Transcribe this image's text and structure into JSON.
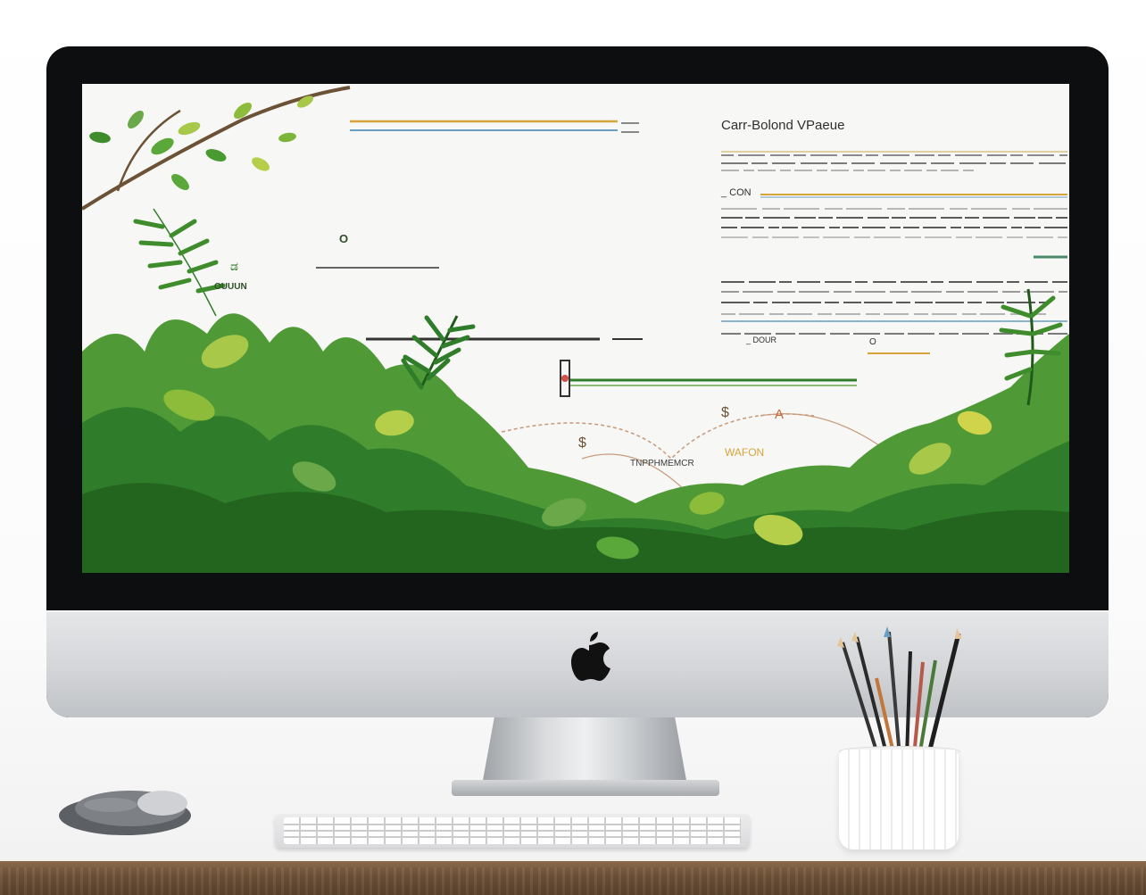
{
  "screen": {
    "heading": "Carr-Bolond  VPaeue",
    "left_label_small": "ಡ",
    "left_label": "OUUUN",
    "small_mark": "O",
    "field_label": "_ CON",
    "bottom_field": "_ DOUR",
    "bottom_mark": "O",
    "flow_label_1": "TNPPHMEMCR",
    "flow_label_2": "WAFON",
    "flow_node_a": "$",
    "flow_node_b": "$",
    "flow_node_c": "A"
  },
  "colors": {
    "leaf_dark": "#2f7d2a",
    "leaf_mid": "#5aa83a",
    "leaf_light": "#a8c84a",
    "accent_gold": "#d6a43a",
    "accent_blue": "#6a9ec2"
  }
}
